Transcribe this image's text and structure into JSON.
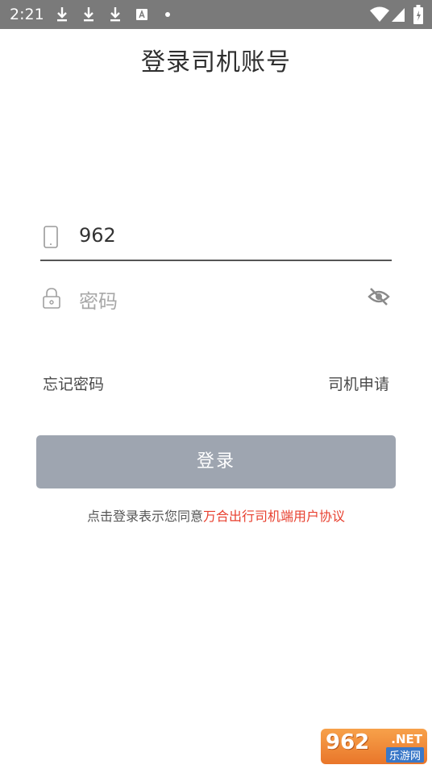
{
  "status_bar": {
    "time": "2:21",
    "icons": [
      "download-icon",
      "download-icon",
      "download-icon",
      "a-icon",
      "dot-icon",
      "wifi-icon",
      "signal-icon",
      "battery-icon"
    ]
  },
  "title": "登录司机账号",
  "phone_field": {
    "value": "962",
    "icon": "phone-icon"
  },
  "password_field": {
    "placeholder": "密码",
    "icon": "lock-icon",
    "toggle_icon": "eye-off-icon"
  },
  "links": {
    "forgot": "忘记密码",
    "apply": "司机申请"
  },
  "login_button": {
    "label": "登录",
    "color": "#9ea5b0"
  },
  "agreement": {
    "prefix": "点击登录表示您同意",
    "link": "万合出行司机端用户协议",
    "link_color": "#e8402f"
  },
  "watermark": {
    "brand": "962",
    "net": ".NET",
    "sub": "乐游网"
  }
}
